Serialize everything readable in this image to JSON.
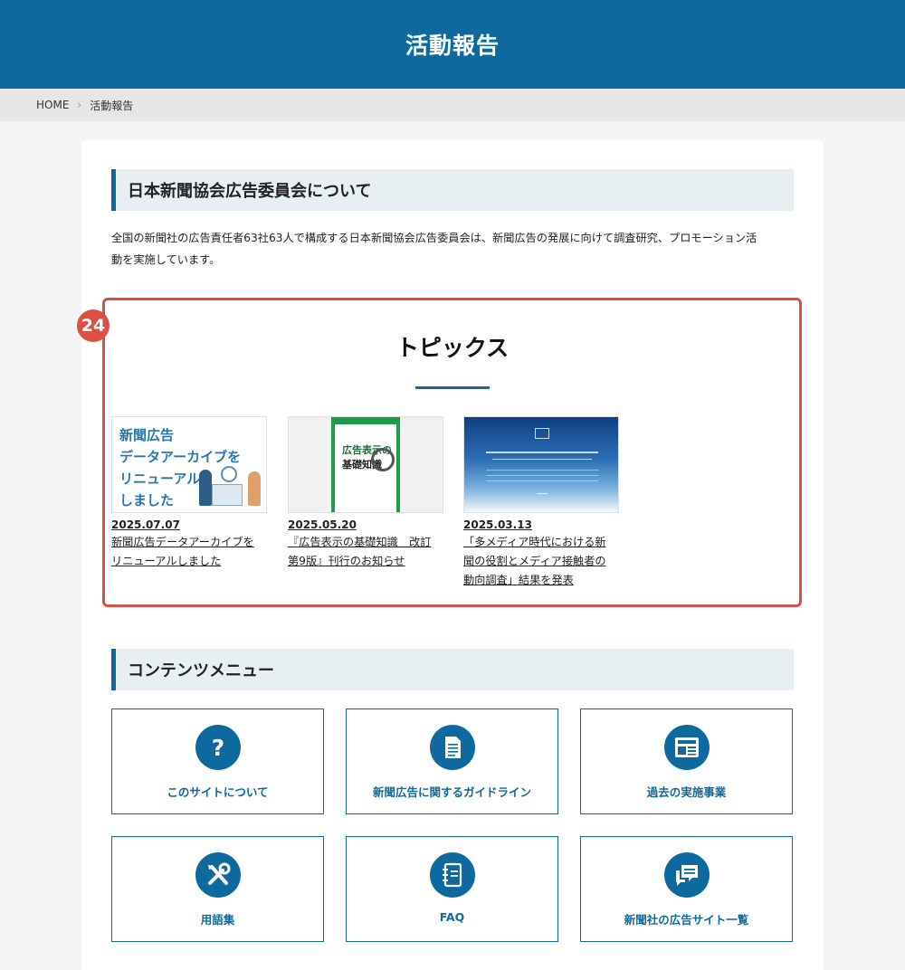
{
  "header": {
    "title": "活動報告"
  },
  "breadcrumb": {
    "home": "HOME",
    "current": "活動報告"
  },
  "about": {
    "heading": "日本新聞協会広告委員会について",
    "text_line1": "全国の新聞社の広告責任者63社63人で構成する日本新聞協会広告委員会は、新聞広告の発展に向けて調査研究、プロモーション活",
    "text_line2": "動を実施しています。"
  },
  "topics": {
    "badge": "24",
    "title": "トピックス",
    "items": [
      {
        "date": "2025.07.07",
        "title_lines": [
          "新聞広告データアーカイブを",
          "リニューアルしました"
        ],
        "thumb_text": [
          "新聞広告",
          "データアーカイブを",
          "リニューアル",
          "しました"
        ]
      },
      {
        "date": "2025.05.20",
        "title_lines": [
          "『広告表示の基礎知識　改訂",
          "第9版』刊行のお知らせ"
        ],
        "thumb_text": [
          "広告表示の",
          "基礎知識"
        ]
      },
      {
        "date": "2025.03.13",
        "title_lines": [
          "「多メディア時代における新",
          "聞の役割とメディア接触者の",
          "動向調査」結果を発表"
        ],
        "thumb_text": []
      }
    ]
  },
  "menu": {
    "heading": "コンテンツメニュー",
    "items": [
      {
        "label": "このサイトについて",
        "icon": "question-icon"
      },
      {
        "label": "新聞広告に関するガイドライン",
        "icon": "document-icon"
      },
      {
        "label": "過去の実施事業",
        "icon": "newspaper-icon"
      },
      {
        "label": "用語集",
        "icon": "tools-icon"
      },
      {
        "label": "FAQ",
        "icon": "notebook-icon"
      },
      {
        "label": "新聞社の広告サイト一覧",
        "icon": "chat-icon"
      }
    ]
  },
  "colors": {
    "brand": "#0e6a9e",
    "highlight": "#dc4f45",
    "heading_bg": "#e8eff3"
  }
}
